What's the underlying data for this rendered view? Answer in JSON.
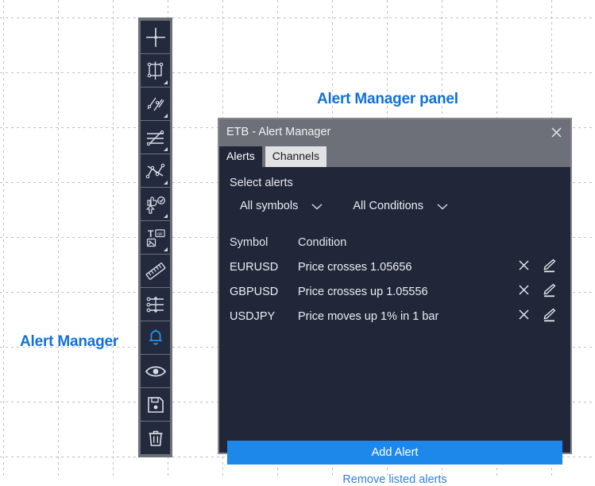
{
  "annotations": {
    "panel_label": "Alert Manager panel",
    "toolbar_label": "Alert Manager"
  },
  "toolbar": {
    "name": "drawing-tools-toolbar",
    "active_tool": "alert-bell",
    "active_color": "#2196f3",
    "items": [
      {
        "icon": "crosshair-icon",
        "label": "Crosshair",
        "has_corner": false,
        "active": false
      },
      {
        "icon": "frame-selection-icon",
        "label": "Frame / Chart Pattern",
        "has_corner": true,
        "active": false
      },
      {
        "icon": "trend-line-icon",
        "label": "Trend Line Tools",
        "has_corner": true,
        "active": false
      },
      {
        "icon": "parallel-channel-icon",
        "label": "Channel Tools",
        "has_corner": true,
        "active": false
      },
      {
        "icon": "pitchfork-icon",
        "label": "Pitchfork Tools",
        "has_corner": true,
        "active": false
      },
      {
        "icon": "thumbs-up-arrow-icon",
        "label": "Arrows And Shapes",
        "has_corner": true,
        "active": false
      },
      {
        "icon": "text-annotation-icon",
        "label": "Text And Notes",
        "has_corner": true,
        "active": false
      },
      {
        "icon": "ruler-icon",
        "label": "Measure",
        "has_corner": false,
        "active": false
      },
      {
        "icon": "magnet-levels-icon",
        "label": "Levels / Magnet",
        "has_corner": false,
        "active": false
      },
      {
        "icon": "bell-icon",
        "label": "Alert Manager",
        "has_corner": false,
        "active": true
      },
      {
        "icon": "eye-icon",
        "label": "Show / Hide Drawings",
        "has_corner": false,
        "active": false
      },
      {
        "icon": "save-disk-icon",
        "label": "Save Drawings",
        "has_corner": false,
        "active": false
      },
      {
        "icon": "trash-icon",
        "label": "Remove Drawings",
        "has_corner": false,
        "active": false
      }
    ]
  },
  "panel": {
    "title": "ETB - Alert Manager",
    "close_label": "×",
    "tabs": [
      {
        "label": "Alerts",
        "active": true
      },
      {
        "label": "Channels",
        "active": false
      }
    ],
    "section_label": "Select alerts",
    "filters": [
      {
        "name": "symbol-filter",
        "value": "All symbols"
      },
      {
        "name": "condition-filter",
        "value": "All Conditions"
      }
    ],
    "table": {
      "columns": [
        "Symbol",
        "Condition"
      ],
      "rows": [
        {
          "symbol": "EURUSD",
          "condition": "Price crosses 1.05656"
        },
        {
          "symbol": "GBPUSD",
          "condition": "Price crosses up 1.05556"
        },
        {
          "symbol": "USDJPY",
          "condition": "Price moves up 1% in 1 bar"
        }
      ],
      "delete_icon": "close-x-icon",
      "edit_icon": "pencil-edit-icon"
    },
    "add_alert_label": "Add Alert",
    "remove_listed_label": "Remove listed alerts",
    "accent_color": "#1e88ea",
    "link_color": "#2f7fe0",
    "body_color": "#222639",
    "titlebar_color": "#6d7078"
  }
}
